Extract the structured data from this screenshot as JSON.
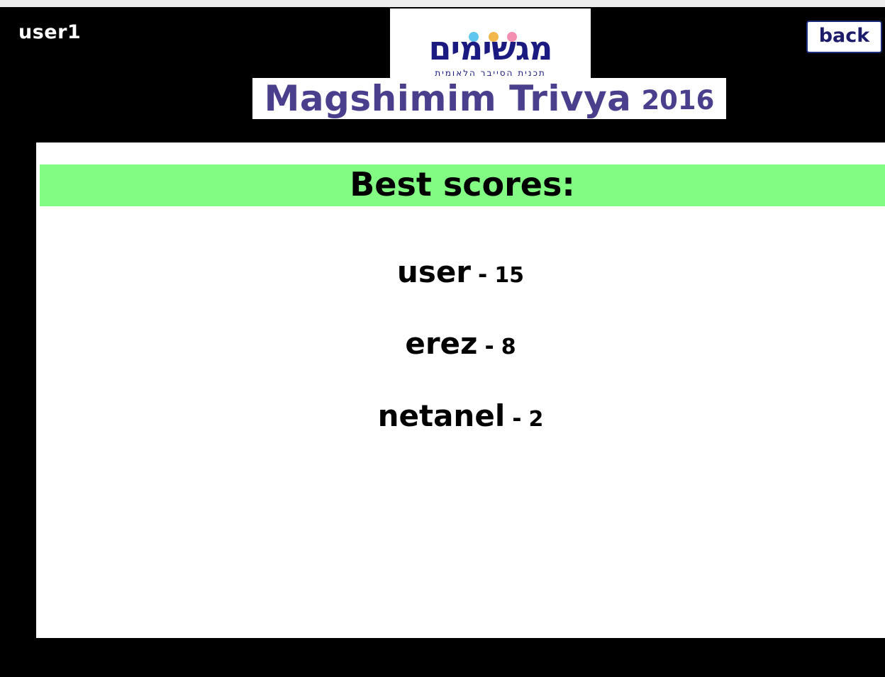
{
  "header": {
    "username": "user1",
    "back_label": "back",
    "logo": {
      "hebrew_name": "מגשימים",
      "tagline": "תכנית הסייבר הלאומית",
      "dot_colors": [
        "#f59ac4",
        "#5fc6ef",
        "#f2b84b",
        "#f48fb1"
      ]
    },
    "title": "Magshimim Trivya",
    "title_year": "2016"
  },
  "scores": {
    "heading": "Best scores:",
    "separator": "-",
    "entries": [
      {
        "name": "user",
        "score": "15"
      },
      {
        "name": "erez",
        "score": "8"
      },
      {
        "name": "netanel",
        "score": "2"
      }
    ]
  },
  "colors": {
    "background": "#000000",
    "heading_banner": "#83fc83",
    "title_text": "#4a3f8c",
    "logo_text": "#1a1a80"
  }
}
